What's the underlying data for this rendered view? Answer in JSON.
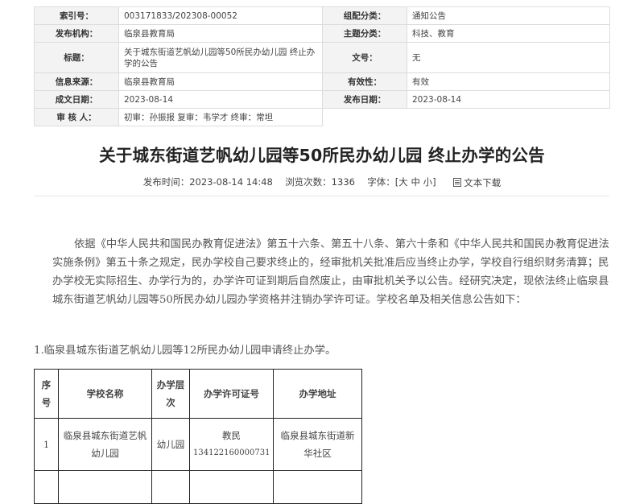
{
  "meta": {
    "index_label": "索引号：",
    "index_value": "003171833/202308-00052",
    "category_label": "组配分类：",
    "category_value": "通知公告",
    "issuer_label": "发布机构：",
    "issuer_value": "临泉县教育局",
    "topic_label": "主题分类：",
    "topic_value": "科技、教育",
    "title_label": "标题：",
    "title_value": "关于城东街道艺帆幼儿园等50所民办幼儿园 终止办学的公告",
    "docno_label": "文号：",
    "docno_value": "无",
    "source_label": "信息来源：",
    "source_value": "临泉县教育局",
    "validity_label": "有效性：",
    "validity_value": "有效",
    "created_label": "成文日期：",
    "created_value": "2023-08-14",
    "published_label": "发布日期：",
    "published_value": "2023-08-14",
    "review_label": "审 核 人：",
    "review_value": "初审：孙振报    复审：韦学才    终审：常坦"
  },
  "article": {
    "title": "关于城东街道艺帆幼儿园等50所民办幼儿园 终止办学的公告",
    "publish_time": "发布时间：2023-08-14 14:48",
    "views": "浏览次数：1336",
    "font_label": "字体：[",
    "font_large": "大",
    "font_medium": "中",
    "font_small": "小",
    "font_close": "]",
    "print_label": "文本下载",
    "paragraph": "依据《中华人民共和国民办教育促进法》第五十六条、第五十八条、第六十条和《中华人民共和国民办教育促进法实施条例》第五十条之规定，民办学校自己要求终止的，经审批机关批准后应当终止办学，学校自行组织财务清算；民办学校无实际招生、办学行为的，办学许可证到期后自然废止，由审批机关予以公告。经研究决定，现依法终止临泉县城东街道艺帆幼儿园等50所民办幼儿园办学资格并注销办学许可证。学校名单及相关信息公告如下：",
    "subheading": "1.临泉县城东街道艺帆幼儿园等12所民办幼儿园申请终止办学。"
  },
  "schools_table": {
    "headers": [
      "序号",
      "学校名称",
      "办学层次",
      "办学许可证号",
      "办学地址"
    ],
    "rows": [
      {
        "no": "1",
        "name": "临泉县城东街道艺帆幼儿园",
        "level": "幼儿园",
        "permit_prefix": "教民",
        "permit_code": "134122160000731",
        "address": "临泉县城东街道新华社区"
      }
    ]
  }
}
